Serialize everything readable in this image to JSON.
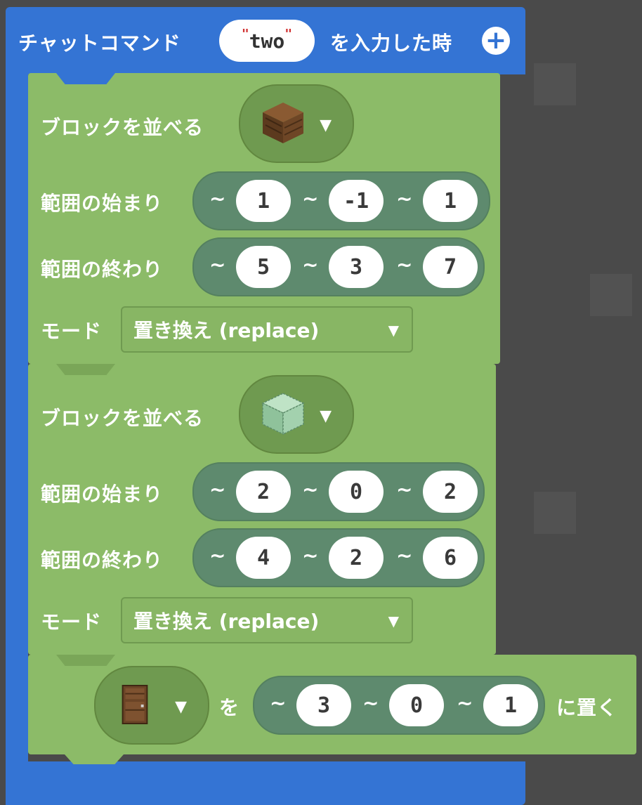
{
  "event": {
    "title": "チャットコマンド",
    "command": "two",
    "suffix": "を入力した時",
    "add_icon": "plus-circle-icon"
  },
  "blocks": [
    {
      "label": "ブロックを並べる",
      "item_icon": "oak-log-icon",
      "start_label": "範囲の始まり",
      "start": [
        "1",
        "-1",
        "1"
      ],
      "end_label": "範囲の終わり",
      "end": [
        "5",
        "3",
        "7"
      ],
      "mode_label": "モード",
      "mode": "置き換え (replace)"
    },
    {
      "label": "ブロックを並べる",
      "item_icon": "glass-block-icon",
      "start_label": "範囲の始まり",
      "start": [
        "2",
        "0",
        "2"
      ],
      "end_label": "範囲の終わり",
      "end": [
        "4",
        "2",
        "6"
      ],
      "mode_label": "モード",
      "mode": "置き換え (replace)"
    }
  ],
  "place": {
    "item_icon": "wooden-door-icon",
    "particle": "を",
    "pos": [
      "3",
      "0",
      "1"
    ],
    "suffix": "に置く"
  },
  "tilde": "~",
  "colors": {
    "event_blue": "#3474d4",
    "block_green": "#8cbb68",
    "pill_green": "#5e8a6e",
    "background": "#4a4a4a"
  }
}
